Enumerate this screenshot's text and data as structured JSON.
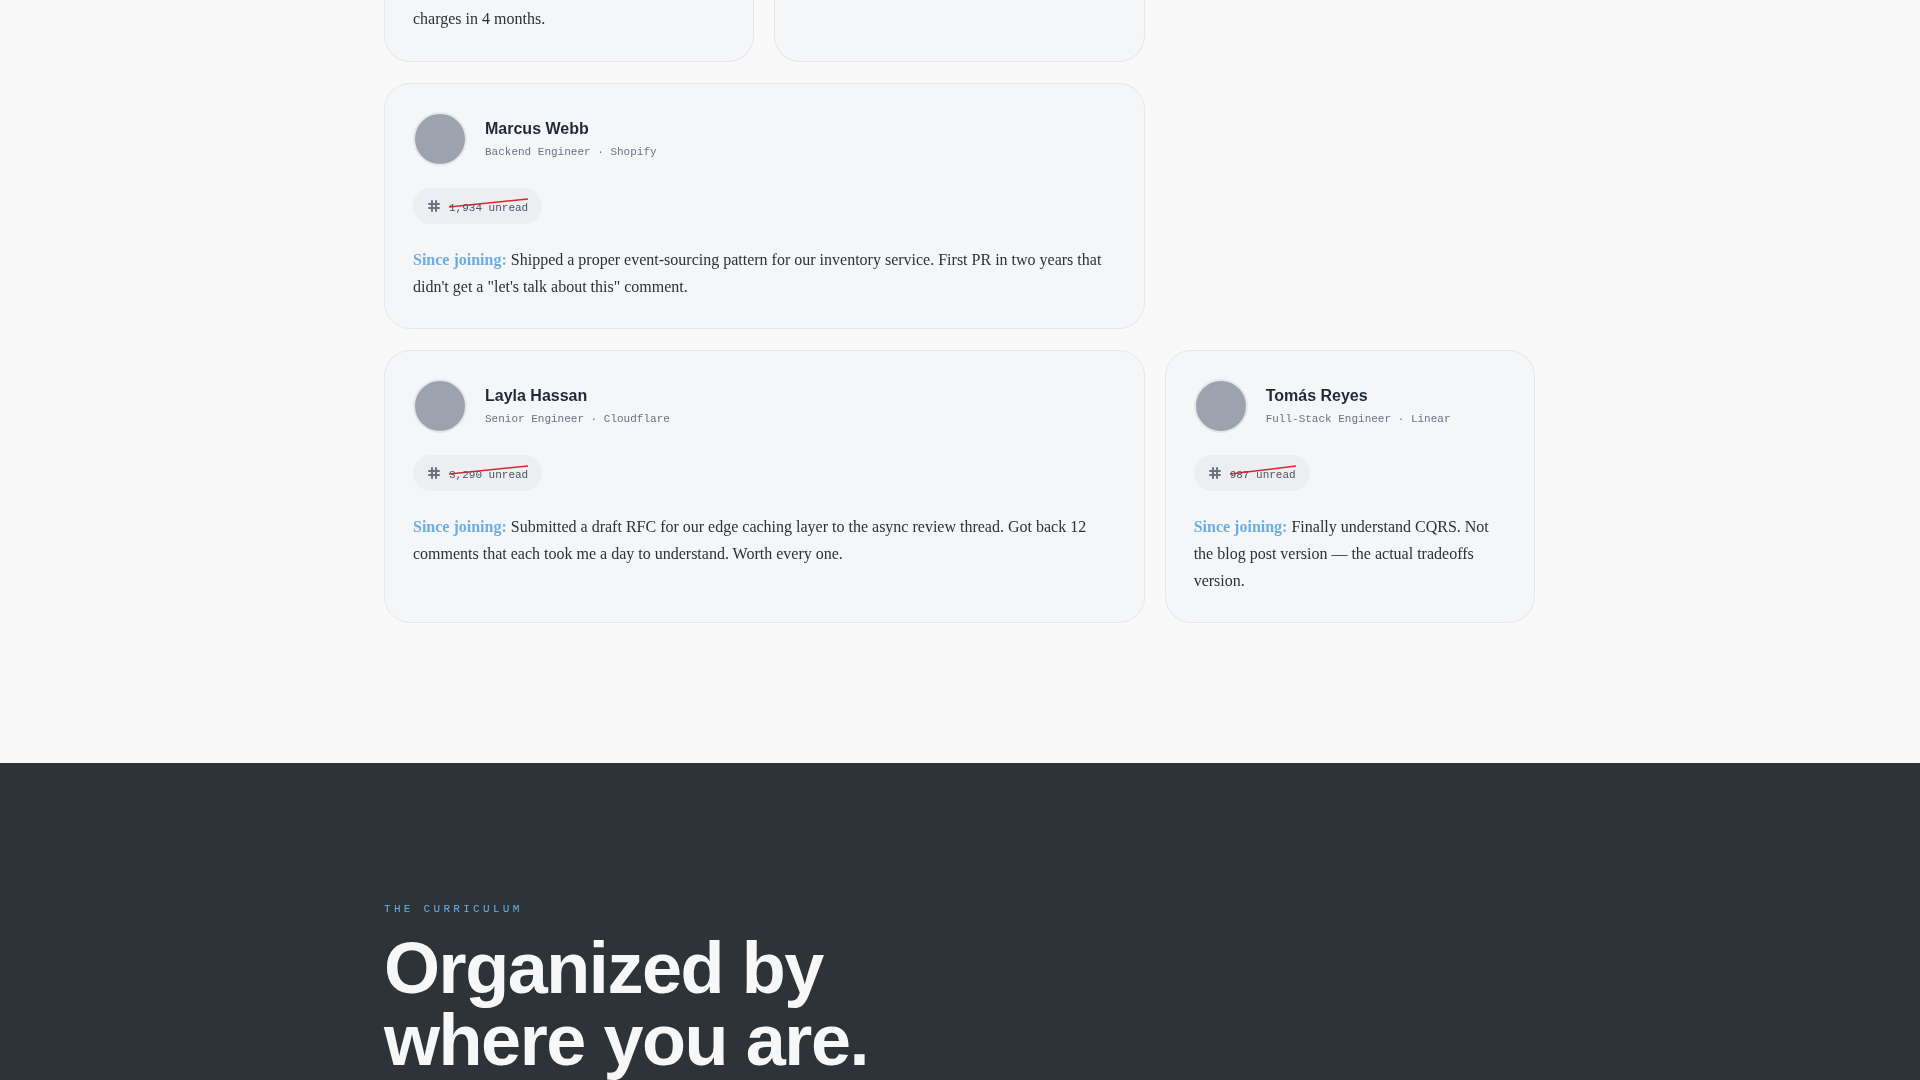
{
  "top_cards": [
    {
      "quote_tail": "charges in 4 months."
    }
  ],
  "testimonials": [
    {
      "name": "Marcus Webb",
      "role": "Backend Engineer · Shopify",
      "unread": "1,934 unread",
      "struck": true,
      "lead": "Since joining:",
      "quote": "Shipped a proper event-sourcing pattern for our inventory service. First PR in two years that didn't get a \"let's talk about this\" comment."
    },
    {
      "name": "Layla Hassan",
      "role": "Senior Engineer · Cloudflare",
      "unread": "3,290 unread",
      "struck": true,
      "lead": "Since joining:",
      "quote": "Submitted a draft RFC for our edge caching layer to the async review thread. Got back 12 comments that each took me a day to understand. Worth every one."
    },
    {
      "name": "Tomás Reyes",
      "role": "Full-Stack Engineer · Linear",
      "unread": "987 unread",
      "struck": true,
      "lead": "Since joining:",
      "quote": "Finally understand CQRS. Not the blog post version — the actual tradeoffs version."
    }
  ],
  "curriculum": {
    "eyebrow": "THE CURRICULUM",
    "heading": "Organized by where you are."
  }
}
